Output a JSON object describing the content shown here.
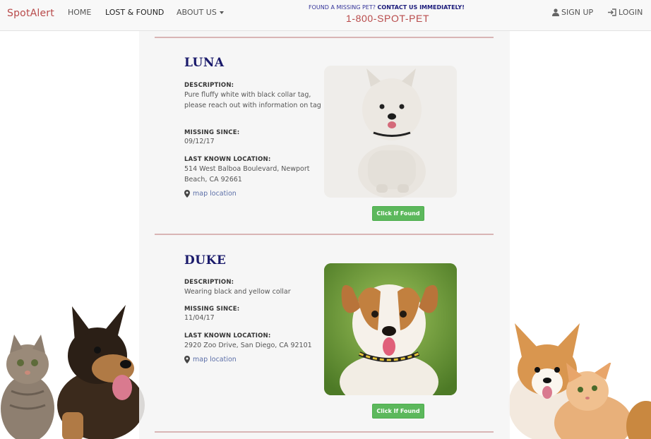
{
  "navbar": {
    "brand": "SpotAlert",
    "links": [
      "HOME",
      "LOST & FOUND",
      "ABOUT US"
    ],
    "hotline": {
      "prefix": "FOUND A MISSING PET?",
      "cta": "CONTACT US IMMEDIATELY!",
      "number": "1-800-SPOT-PET"
    },
    "signup": "SIGN UP",
    "login": "LOGIN"
  },
  "pets": [
    {
      "name": "LUNA",
      "description_label": "DESCRIPTION:",
      "description": "Pure fluffy white with black collar tag, please reach out with information on tag",
      "missing_label": "MISSING SINCE:",
      "missing_since": "09/12/17",
      "location_label": "LAST KNOWN LOCATION:",
      "location": "514 West Balboa Boulevard, Newport Beach, CA 92661",
      "map_link": "map location",
      "button": "Click If Found"
    },
    {
      "name": "DUKE",
      "description_label": "DESCRIPTION:",
      "description": "Wearing black and yellow collar",
      "missing_label": "MISSING SINCE:",
      "missing_since": "11/04/17",
      "location_label": "LAST KNOWN LOCATION:",
      "location": "2920 Zoo Drive, San Diego, CA 92101",
      "map_link": "map location",
      "button": "Click If Found"
    }
  ],
  "colors": {
    "brand": "#b84a4a",
    "pet_name": "#1a1a6b",
    "button": "#5cb85c",
    "rule": "#d9b5b5"
  }
}
